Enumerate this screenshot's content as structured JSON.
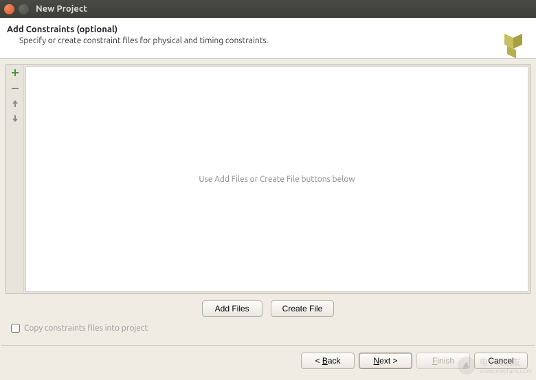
{
  "window": {
    "title": "New Project"
  },
  "header": {
    "title": "Add Constraints (optional)",
    "description": "Specify or create constraint files for physical and timing constraints."
  },
  "fileList": {
    "placeholder": "Use Add Files or Create File buttons below"
  },
  "buttons": {
    "addFiles": "Add Files",
    "createFile": "Create File"
  },
  "checkbox": {
    "copyConstraints": "Copy constraints files into project",
    "checked": false
  },
  "nav": {
    "back": "< Back",
    "next": "Next >",
    "finish": "Finish",
    "cancel": "Cancel"
  },
  "watermark": {
    "text1": "电子发烧友",
    "text2": "www.elecfans.com"
  }
}
